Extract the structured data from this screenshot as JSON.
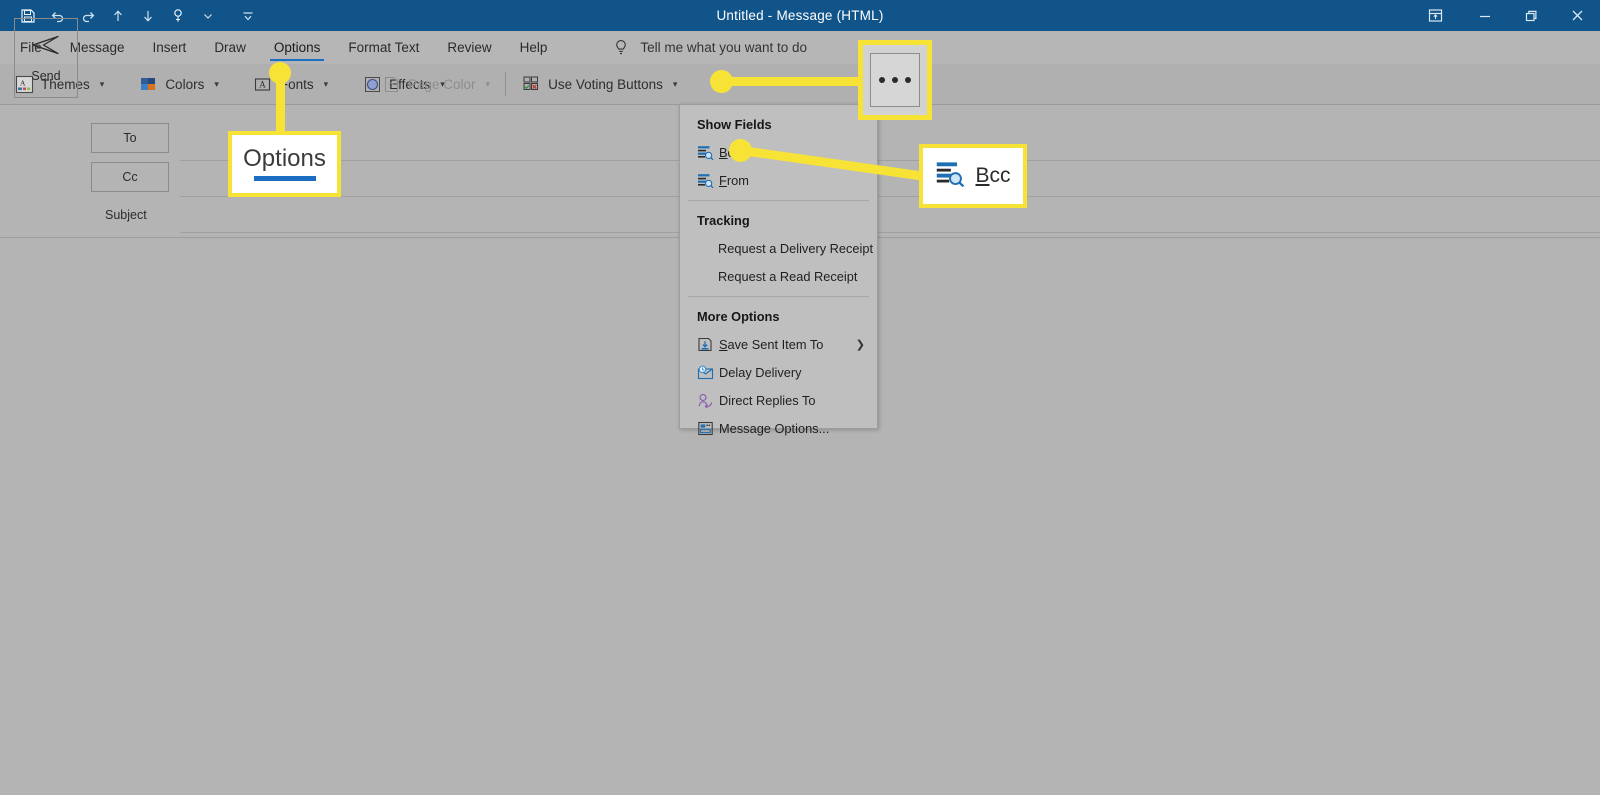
{
  "window": {
    "title": "Untitled  -  Message (HTML)",
    "quick_access": [
      {
        "name": "save-icon",
        "glyph": "save"
      },
      {
        "name": "undo-icon",
        "glyph": "undo"
      },
      {
        "name": "redo-icon",
        "glyph": "redo"
      },
      {
        "name": "move-up-icon",
        "glyph": "up"
      },
      {
        "name": "move-down-icon",
        "glyph": "down"
      },
      {
        "name": "touch-mode-icon",
        "glyph": "touch"
      },
      {
        "name": "touch-mode-caret-icon",
        "glyph": "caret"
      },
      {
        "name": "customize-quick-access-toolbar-icon",
        "glyph": "qat-caret"
      }
    ],
    "controls": {
      "ribbon_display": "ribbon-display-options-icon",
      "minimize": "minimize-icon",
      "restore": "restore-icon",
      "close": "close-icon"
    }
  },
  "tabs": [
    {
      "label": "File",
      "active": false
    },
    {
      "label": "Message",
      "active": false
    },
    {
      "label": "Insert",
      "active": false
    },
    {
      "label": "Draw",
      "active": false
    },
    {
      "label": "Options",
      "active": true
    },
    {
      "label": "Format Text",
      "active": false
    },
    {
      "label": "Review",
      "active": false
    },
    {
      "label": "Help",
      "active": false
    }
  ],
  "tell_me": {
    "placeholder": "Tell me what you want to do",
    "icon": "lightbulb-icon"
  },
  "ribbon": {
    "buttons": [
      {
        "label": "Themes",
        "icon": "themes-icon",
        "caret": true,
        "disabled": false
      },
      {
        "label": "Colors",
        "icon": "colors-icon",
        "caret": true,
        "disabled": false
      },
      {
        "label": "Fonts",
        "icon": "fonts-icon",
        "caret": true,
        "disabled": false
      },
      {
        "label": "Effects",
        "icon": "effects-icon",
        "caret": true,
        "disabled": false
      },
      {
        "label": "Page Color",
        "icon": "page-color-icon",
        "caret": true,
        "disabled": true
      },
      {
        "label": "Use Voting Buttons",
        "icon": "voting-buttons-icon",
        "caret": true,
        "disabled": false
      }
    ],
    "more_commands_label": "...",
    "dialog_launcher": "dialog-box-launcher-icon",
    "collapse": "collapse-ribbon-chevron-icon"
  },
  "compose": {
    "send_label": "Send",
    "to_label": "To",
    "cc_label": "Cc",
    "subject_label": "Subject"
  },
  "menu": {
    "sections": [
      {
        "heading": "Show Fields",
        "items": [
          {
            "label": "Bcc",
            "icon": "bcc-field-icon",
            "underline_index": 0,
            "submenu": false
          },
          {
            "label": "From",
            "icon": "from-field-icon",
            "underline_index": 0,
            "submenu": false
          }
        ]
      },
      {
        "heading": "Tracking",
        "items": [
          {
            "label": "Request a Delivery Receipt",
            "icon": "",
            "submenu": false
          },
          {
            "label": "Request a Read Receipt",
            "icon": "",
            "submenu": false
          }
        ]
      },
      {
        "heading": "More Options",
        "items": [
          {
            "label": "Save Sent Item To",
            "icon": "save-sent-item-icon",
            "underline_index": 0,
            "submenu": true
          },
          {
            "label": "Delay Delivery",
            "icon": "delay-delivery-icon",
            "submenu": false
          },
          {
            "label": "Direct Replies To",
            "icon": "direct-replies-icon",
            "submenu": false
          },
          {
            "label": "Message Options...",
            "icon": "message-options-icon",
            "submenu": false
          }
        ]
      }
    ]
  },
  "annotations": {
    "highlight_color": "#f7e335",
    "callouts": [
      {
        "name": "options-callout",
        "text": "Options"
      },
      {
        "name": "bcc-callout",
        "text": "Bcc",
        "icon": "bcc-field-icon"
      },
      {
        "name": "more-commands-callout",
        "text": "..."
      }
    ]
  },
  "colors": {
    "titlebar": "#10548a",
    "accent": "#1b6ec2",
    "page_background": "#b4b4b4",
    "ribbon": "#b0b0b0",
    "menu_background": "#bfbfbf",
    "highlight": "#f7e335"
  }
}
